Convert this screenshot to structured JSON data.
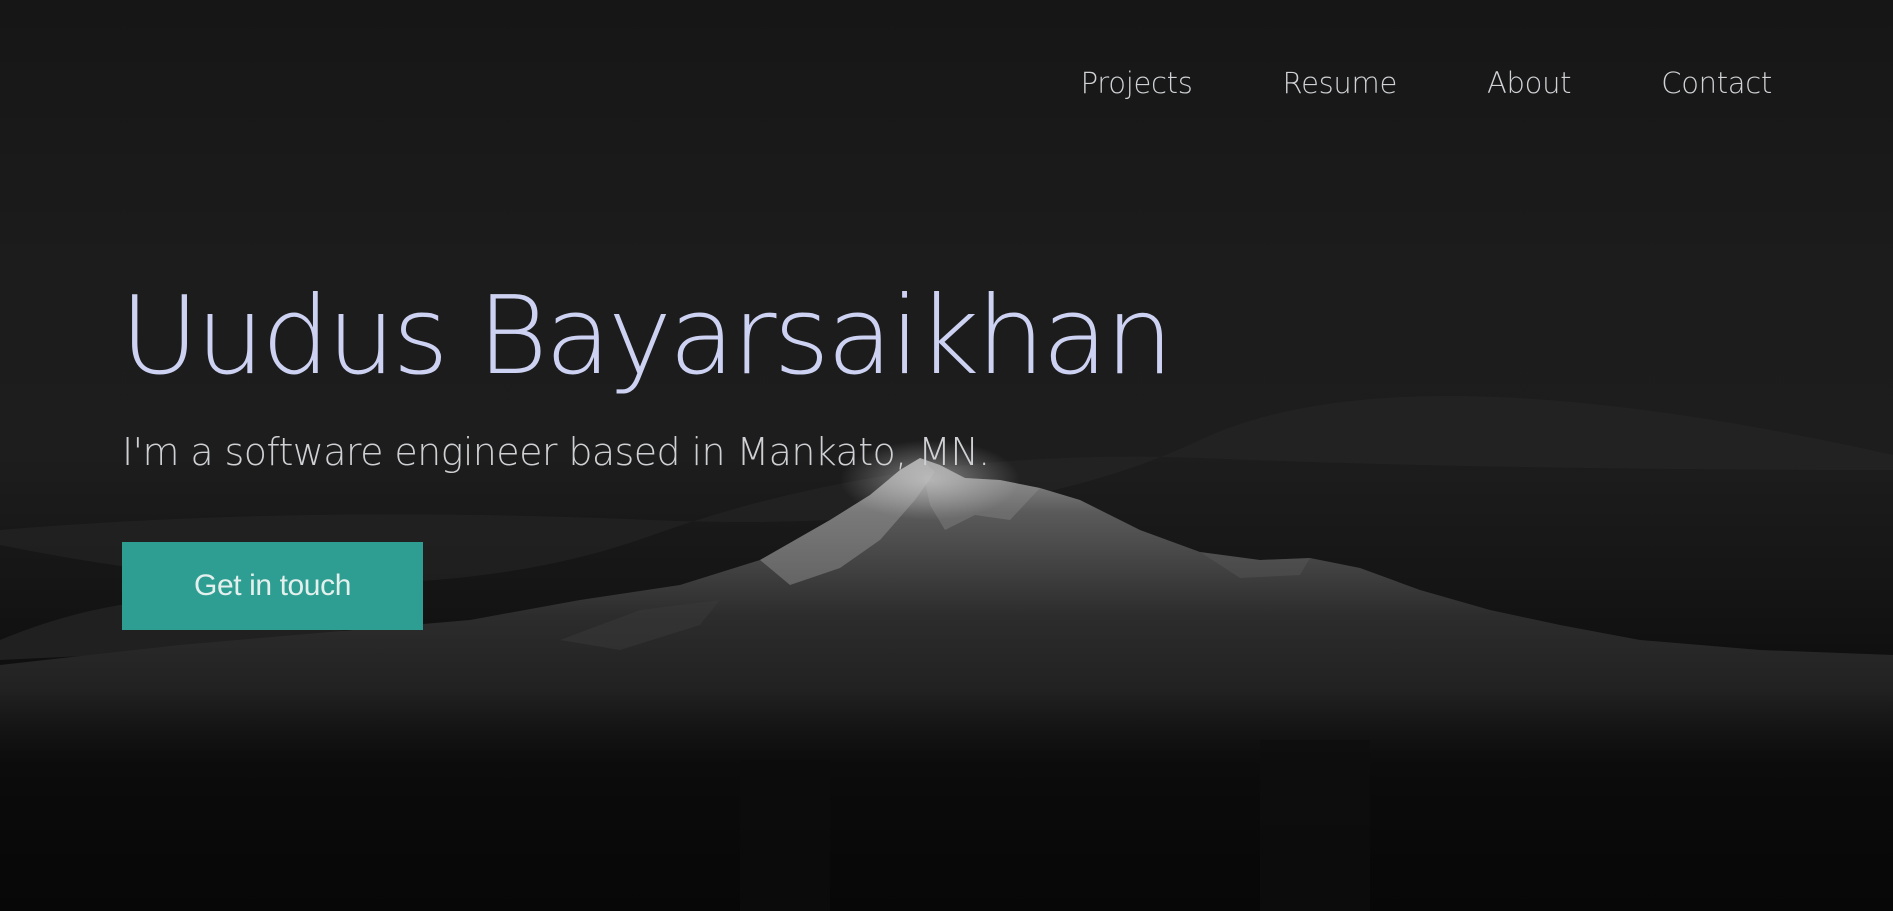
{
  "nav": {
    "items": [
      {
        "label": "Projects"
      },
      {
        "label": "Resume"
      },
      {
        "label": "About"
      },
      {
        "label": "Contact"
      }
    ]
  },
  "hero": {
    "name": "Uudus Bayarsaikhan",
    "tagline": "I'm a software engineer based in Mankato, MN.",
    "cta_label": "Get in touch",
    "background": "dark-mountain-photo"
  },
  "colors": {
    "accent": "#2f9e92",
    "headline": "#cdd1f2",
    "text": "#cfd0d3",
    "background": "#1b1b1b"
  }
}
